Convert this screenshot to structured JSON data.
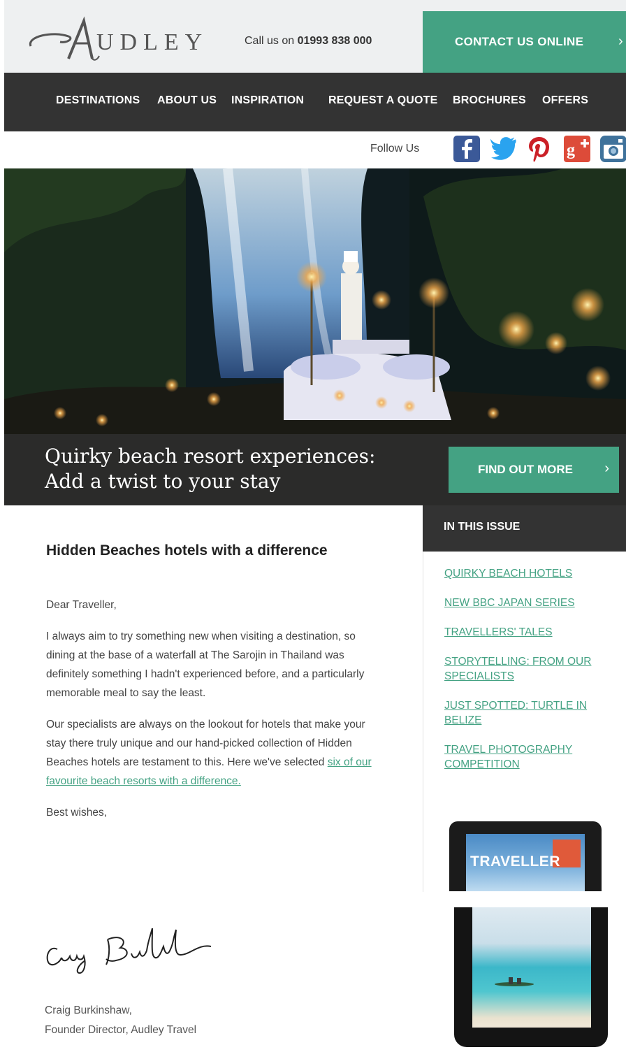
{
  "header": {
    "logo_text": "UDLEY",
    "phone_prefix": "Call us on",
    "phone_number": "01993 838 000",
    "contact_label": "CONTACT US ONLINE",
    "contact_chevron": "›"
  },
  "nav": {
    "items": [
      "DESTINATIONS",
      "ABOUT US",
      "INSPIRATION",
      "REQUEST A QUOTE",
      "BROCHURES",
      "OFFERS"
    ]
  },
  "social": {
    "label": "Follow Us",
    "icons": [
      "facebook-icon",
      "twitter-icon",
      "pinterest-icon",
      "google-plus-icon",
      "instagram-icon"
    ],
    "colors": {
      "facebook": "#3b5998",
      "twitter": "#2aa3ef",
      "pinterest": "#cb2027",
      "google_plus": "#dd4b39",
      "instagram": "#3f729b"
    }
  },
  "hero": {
    "title_line1": "Quirky beach resort experiences:",
    "title_line2": "Add a twist to your stay",
    "button_label": "FIND OUT MORE",
    "button_chevron": "›"
  },
  "article": {
    "headline": "Hidden Beaches hotels with a difference",
    "greeting": "Dear Traveller,",
    "para1": "I always aim to try something new when visiting a destination, so dining at the base of a waterfall at The Sarojin in Thailand was definitely something I hadn't experienced before, and a particularly memorable meal to say the least.",
    "para2_text": "Our specialists are always on the lookout for hotels that make your stay there truly unique and our hand-picked collection of Hidden Beaches hotels are testament to this. Here we've selected",
    "para2_link": "six of our favourite beach resorts with a difference.",
    "closing": "Best wishes,",
    "signer_name": "Craig Burkinshaw,",
    "signer_title": "Founder Director, Audley Travel"
  },
  "sidebar": {
    "heading": "IN THIS ISSUE",
    "links": [
      "QUIRKY BEACH HOTELS",
      "NEW BBC JAPAN SERIES",
      "TRAVELLERS' TALES",
      "STORYTELLING: FROM OUR SPECIALISTS",
      "JUST SPOTTED: TURTLE IN BELIZE",
      "TRAVEL PHOTOGRAPHY COMPETITION"
    ],
    "magazine_title": "TRAVELLER"
  },
  "colors": {
    "accent_green": "#44a283",
    "dark_bar": "#333333",
    "header_bg": "#eef0f1"
  }
}
